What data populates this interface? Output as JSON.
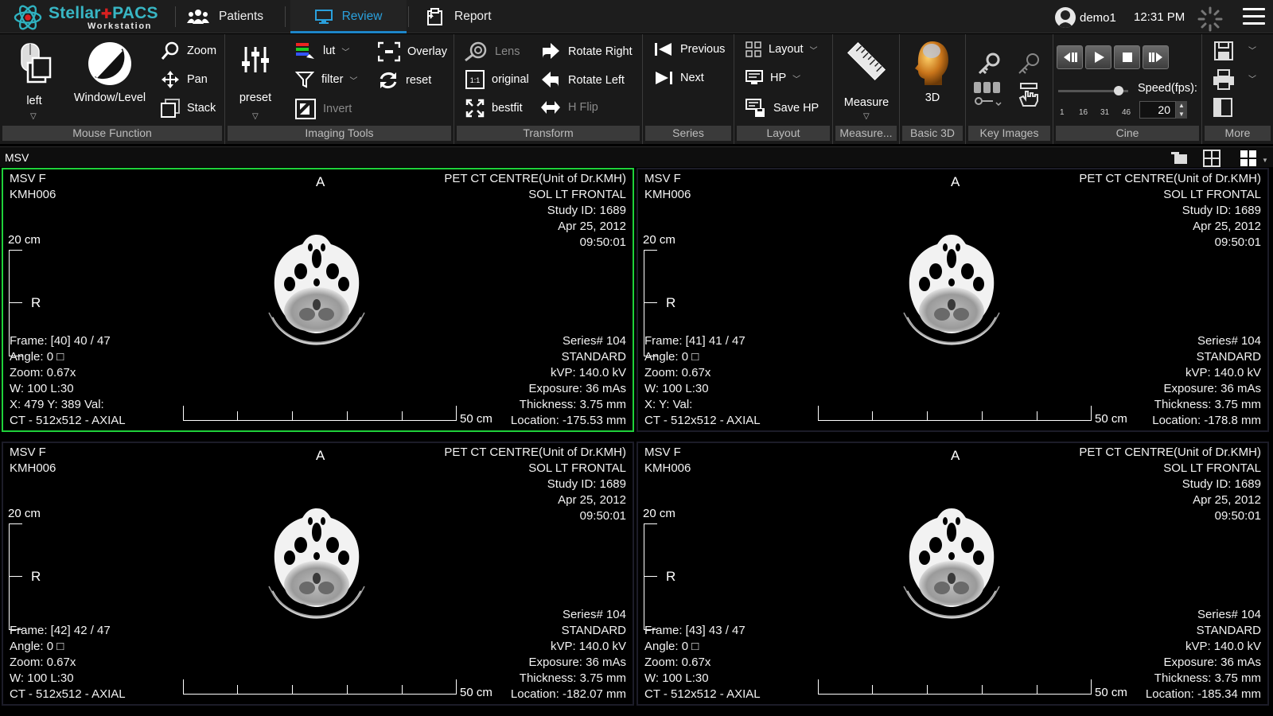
{
  "app": {
    "brand_left": "Stellar",
    "brand_right": "PACS",
    "brand_sub": "Workstation",
    "colors": {
      "accent": "#1e86c8",
      "active_viewport": "#1fd13a",
      "brand": "#38b6c4"
    }
  },
  "nav": {
    "patients": "Patients",
    "review": "Review",
    "report": "Report"
  },
  "user": {
    "name": "demo1",
    "time": "12:31 PM"
  },
  "ribbon": {
    "mouse_function": {
      "label": "Mouse Function",
      "left": "left",
      "window_level": "Window/Level",
      "zoom": "Zoom",
      "pan": "Pan",
      "stack": "Stack"
    },
    "imaging_tools": {
      "label": "Imaging Tools",
      "preset": "preset",
      "lut": "lut",
      "filter": "filter",
      "invert": "Invert",
      "overlay": "Overlay",
      "reset": "reset"
    },
    "transform": {
      "label": "Transform",
      "lens": "Lens",
      "original": "original",
      "bestfit": "bestfit",
      "rotate_right": "Rotate Right",
      "rotate_left": "Rotate Left",
      "hflip": "H Flip"
    },
    "series": {
      "label": "Series",
      "previous": "Previous",
      "next": "Next"
    },
    "layout": {
      "label": "Layout",
      "layout": "Layout",
      "hp": "HP",
      "save_hp": "Save HP"
    },
    "measure": {
      "label": "Measure...",
      "measure": "Measure"
    },
    "basic3d": {
      "label": "Basic 3D",
      "btn": "3D"
    },
    "key_images": {
      "label": "Key Images"
    },
    "cine": {
      "label": "Cine",
      "speed_label": "Speed(fps):",
      "speed_value": "20",
      "ticks": [
        "1",
        "16",
        "31",
        "46"
      ]
    },
    "more": {
      "label": "More"
    }
  },
  "viewer": {
    "title": "MSV",
    "viewports": [
      {
        "name": "MSV F",
        "id": "KMH006",
        "institution": "PET CT CENTRE(Unit of Dr.KMH)",
        "study": "SOL LT FRONTAL",
        "study_id": "Study ID: 1689",
        "date": "Apr 25, 2012",
        "time": "09:50:01",
        "orient_top": "A",
        "orient_left": "R",
        "scale_v": "20 cm",
        "scale_h": "50 cm",
        "frame": "Frame: [40] 40 / 47",
        "angle": "Angle: 0 □",
        "zoom": "Zoom: 0.67x",
        "wl": "W: 100 L:30",
        "xyval": "X: 479 Y: 389 Val:",
        "modality": "CT - 512x512 - AXIAL",
        "series": "Series# 104",
        "kernel": "STANDARD",
        "kvp": "kVP: 140.0 kV",
        "exposure": "Exposure: 36 mAs",
        "thickness": "Thickness: 3.75 mm",
        "location": "Location: -175.53 mm"
      },
      {
        "name": "MSV F",
        "id": "KMH006",
        "institution": "PET CT CENTRE(Unit of Dr.KMH)",
        "study": "SOL LT FRONTAL",
        "study_id": "Study ID: 1689",
        "date": "Apr 25, 2012",
        "time": "09:50:01",
        "orient_top": "A",
        "orient_left": "R",
        "scale_v": "20 cm",
        "scale_h": "50 cm",
        "frame": "Frame: [41] 41 / 47",
        "angle": "Angle: 0 □",
        "zoom": "Zoom: 0.67x",
        "wl": "W: 100 L:30",
        "xyval": "X:  Y:   Val:",
        "modality": "CT - 512x512 - AXIAL",
        "series": "Series# 104",
        "kernel": "STANDARD",
        "kvp": "kVP: 140.0 kV",
        "exposure": "Exposure: 36 mAs",
        "thickness": "Thickness: 3.75 mm",
        "location": "Location: -178.8 mm"
      },
      {
        "name": "MSV F",
        "id": "KMH006",
        "institution": "PET CT CENTRE(Unit of Dr.KMH)",
        "study": "SOL LT FRONTAL",
        "study_id": "Study ID: 1689",
        "date": "Apr 25, 2012",
        "time": "09:50:01",
        "orient_top": "A",
        "orient_left": "R",
        "scale_v": "20 cm",
        "scale_h": "50 cm",
        "frame": "Frame: [42] 42 / 47",
        "angle": "Angle: 0 □",
        "zoom": "Zoom: 0.67x",
        "wl": "W: 100 L:30",
        "xyval": "",
        "modality": "CT - 512x512 - AXIAL",
        "series": "Series# 104",
        "kernel": "STANDARD",
        "kvp": "kVP: 140.0 kV",
        "exposure": "Exposure: 36 mAs",
        "thickness": "Thickness: 3.75 mm",
        "location": "Location: -182.07 mm"
      },
      {
        "name": "MSV F",
        "id": "KMH006",
        "institution": "PET CT CENTRE(Unit of Dr.KMH)",
        "study": "SOL LT FRONTAL",
        "study_id": "Study ID: 1689",
        "date": "Apr 25, 2012",
        "time": "09:50:01",
        "orient_top": "A",
        "orient_left": "R",
        "scale_v": "20 cm",
        "scale_h": "50 cm",
        "frame": "Frame: [43] 43 / 47",
        "angle": "Angle: 0 □",
        "zoom": "Zoom: 0.67x",
        "wl": "W: 100 L:30",
        "xyval": "",
        "modality": "CT - 512x512 - AXIAL",
        "series": "Series# 104",
        "kernel": "STANDARD",
        "kvp": "kVP: 140.0 kV",
        "exposure": "Exposure: 36 mAs",
        "thickness": "Thickness: 3.75 mm",
        "location": "Location: -185.34 mm"
      }
    ]
  }
}
